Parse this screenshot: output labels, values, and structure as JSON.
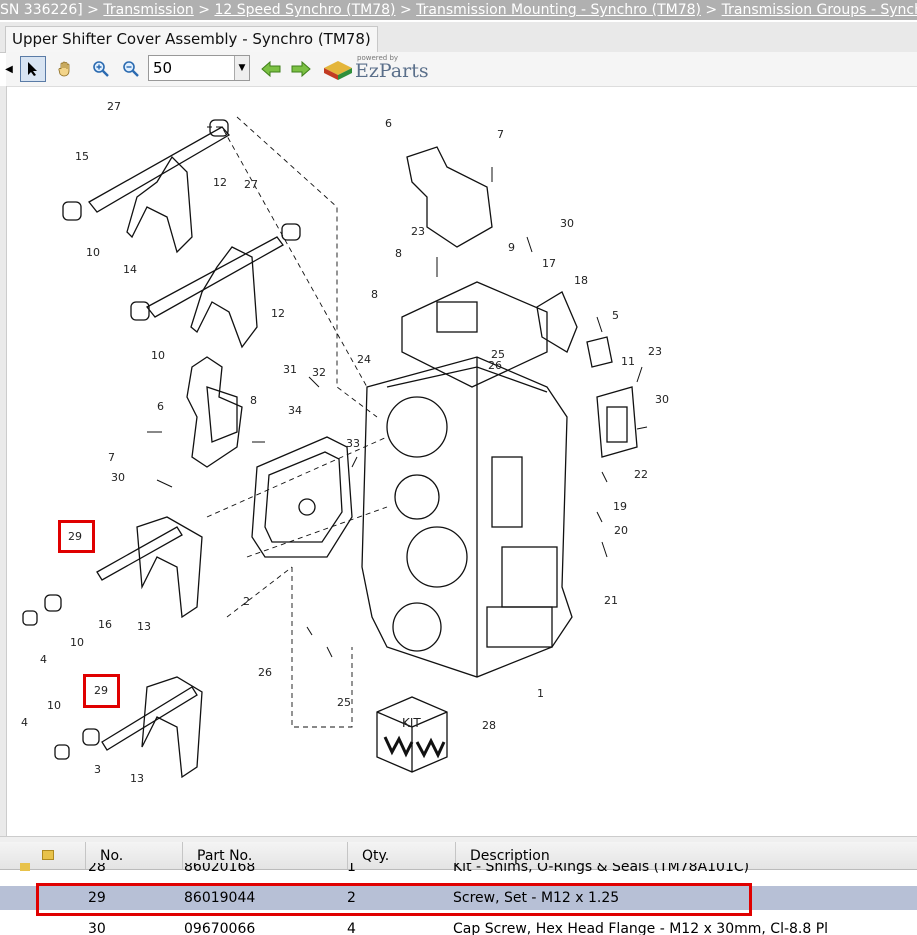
{
  "breadcrumb": {
    "prefix": "SN 336226] > ",
    "items": [
      "Transmission",
      "12 Speed Synchro (TM78)",
      "Transmission Mounting - Synchro (TM78)",
      "Transmission Groups - Synch"
    ],
    "separator": " > "
  },
  "tab": {
    "label": "Upper Shifter Cover Assembly - Synchro (TM78)"
  },
  "toolbar": {
    "zoom_value": "50",
    "brand": "EzParts",
    "brand_tag": "powered by"
  },
  "diagram": {
    "callouts": [
      "27",
      "15",
      "12",
      "27",
      "10",
      "14",
      "12",
      "10",
      "6",
      "8",
      "31",
      "32",
      "34",
      "7",
      "30",
      "33",
      "29",
      "2",
      "16",
      "13",
      "10",
      "4",
      "29",
      "10",
      "4",
      "3",
      "13",
      "26",
      "25",
      "6",
      "7",
      "23",
      "9",
      "30",
      "8",
      "17",
      "18",
      "8",
      "5",
      "24",
      "25",
      "26",
      "11",
      "23",
      "30",
      "22",
      "19",
      "20",
      "21",
      "1",
      "28"
    ],
    "kit_label": "KIT",
    "highlighted_callouts": [
      "29",
      "29"
    ]
  },
  "table": {
    "headers": {
      "no": "No.",
      "part": "Part No.",
      "qty": "Qty.",
      "desc": "Description"
    },
    "rows": [
      {
        "no": "28",
        "part": "86020168",
        "qty": "1",
        "desc": "Kit - Shims, O-Rings & Seals (TM78A101C)"
      },
      {
        "no": "29",
        "part": "86019044",
        "qty": "2",
        "desc": "Screw, Set - M12 x 1.25",
        "selected": true
      },
      {
        "no": "30",
        "part": "09670066",
        "qty": "4",
        "desc": "Cap Screw, Hex Head Flange - M12 x 30mm, Cl-8.8 Pl"
      }
    ]
  },
  "colors": {
    "highlight": "#e00000",
    "selected_row": "#b7c0d6",
    "breadcrumb_bg": "#b0b0b0"
  }
}
